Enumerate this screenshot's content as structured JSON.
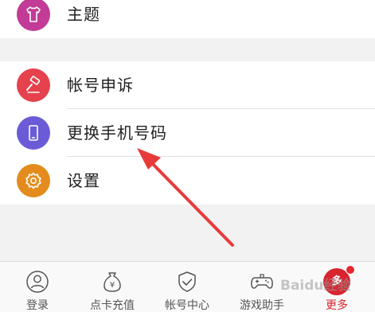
{
  "menu": {
    "items": [
      {
        "label": "主题",
        "icon": "tshirt-icon",
        "color": "#c23b96"
      },
      {
        "label": "帐号申诉",
        "icon": "gavel-icon",
        "color": "#e5424d"
      },
      {
        "label": "更换手机号码",
        "icon": "phone-icon",
        "color": "#6b5bd6"
      },
      {
        "label": "设置",
        "icon": "gear-icon",
        "color": "#e38c1d"
      }
    ]
  },
  "tabbar": {
    "items": [
      {
        "label": "登录",
        "icon": "user-icon",
        "active": false
      },
      {
        "label": "点卡充值",
        "icon": "money-bag-icon",
        "active": false
      },
      {
        "label": "帐号中心",
        "icon": "shield-check-icon",
        "active": false
      },
      {
        "label": "游戏助手",
        "icon": "gamepad-icon",
        "active": false
      },
      {
        "label": "更多",
        "icon": "more-badge-icon",
        "active": true,
        "badge_text": "多"
      }
    ],
    "active_color": "#d8242f"
  },
  "watermark": {
    "bottom_text": "Baidu经验"
  }
}
